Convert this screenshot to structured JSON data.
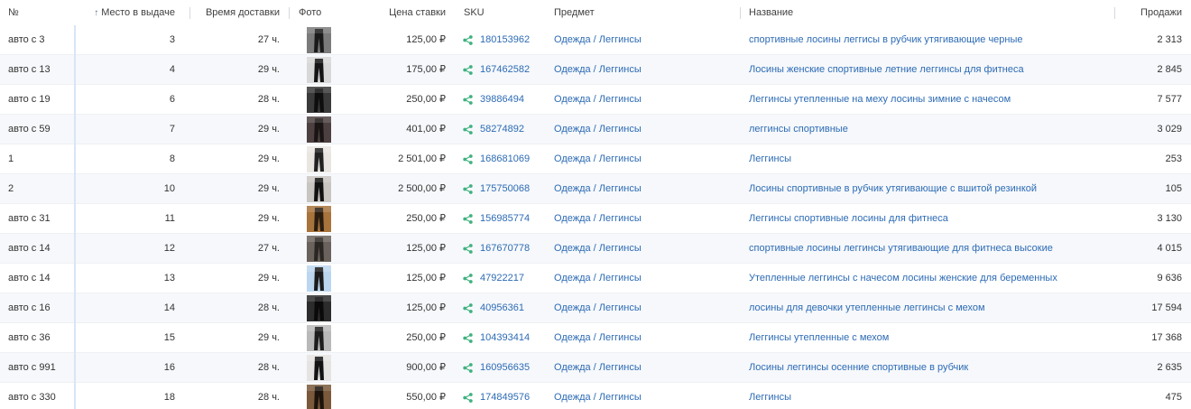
{
  "header": {
    "num": "№",
    "place": "Место в выдаче",
    "place_sort_icon": "sort-ascending-icon",
    "delivery": "Время доставки",
    "photo": "Фото",
    "price": "Цена ставки",
    "sku": "SKU",
    "subject": "Предмет",
    "name": "Название",
    "sales": "Продажи"
  },
  "colors": {
    "link": "#2d6bb5",
    "share_icon": "#3fb27f",
    "stripe": "#f6f8fb",
    "pinned_divider": "#d7e6f5"
  },
  "rows": [
    {
      "num": "авто с 3",
      "place": "3",
      "delivery": "27 ч.",
      "price": "125,00 ₽",
      "sku": "180153962",
      "subject": "Одежда / Леггинсы",
      "name": "спортивные лосины леггисы в рубчик утягивающие черные",
      "sales": "2 313"
    },
    {
      "num": "авто с 13",
      "place": "4",
      "delivery": "29 ч.",
      "price": "175,00 ₽",
      "sku": "167462582",
      "subject": "Одежда / Леггинсы",
      "name": "Лосины женские спортивные летние леггинсы для фитнеса",
      "sales": "2 845"
    },
    {
      "num": "авто с 19",
      "place": "6",
      "delivery": "28 ч.",
      "price": "250,00 ₽",
      "sku": "39886494",
      "subject": "Одежда / Леггинсы",
      "name": "Леггинсы утепленные на меху лосины зимние с начесом",
      "sales": "7 577"
    },
    {
      "num": "авто с 59",
      "place": "7",
      "delivery": "29 ч.",
      "price": "401,00 ₽",
      "sku": "58274892",
      "subject": "Одежда / Леггинсы",
      "name": "леггинсы спортивные",
      "sales": "3 029"
    },
    {
      "num": "1",
      "place": "8",
      "delivery": "29 ч.",
      "price": "2 501,00 ₽",
      "sku": "168681069",
      "subject": "Одежда / Леггинсы",
      "name": "Леггинсы",
      "sales": "253"
    },
    {
      "num": "2",
      "place": "10",
      "delivery": "29 ч.",
      "price": "2 500,00 ₽",
      "sku": "175750068",
      "subject": "Одежда / Леггинсы",
      "name": "Лосины спортивные в рубчик утягивающие с вшитой резинкой",
      "sales": "105"
    },
    {
      "num": "авто с 31",
      "place": "11",
      "delivery": "29 ч.",
      "price": "250,00 ₽",
      "sku": "156985774",
      "subject": "Одежда / Леггинсы",
      "name": "Леггинсы спортивные лосины для фитнеса",
      "sales": "3 130"
    },
    {
      "num": "авто с 14",
      "place": "12",
      "delivery": "27 ч.",
      "price": "125,00 ₽",
      "sku": "167670778",
      "subject": "Одежда / Леггинсы",
      "name": "спортивные лосины леггинсы утягивающие для фитнеса высокие",
      "sales": "4 015"
    },
    {
      "num": "авто с 14",
      "place": "13",
      "delivery": "29 ч.",
      "price": "125,00 ₽",
      "sku": "47922217",
      "subject": "Одежда / Леггинсы",
      "name": "Утепленные леггинсы с начесом лосины женские для беременных",
      "sales": "9 636"
    },
    {
      "num": "авто с 16",
      "place": "14",
      "delivery": "28 ч.",
      "price": "125,00 ₽",
      "sku": "40956361",
      "subject": "Одежда / Леггинсы",
      "name": "лосины для девочки утепленные леггинсы с мехом",
      "sales": "17 594"
    },
    {
      "num": "авто с 36",
      "place": "15",
      "delivery": "29 ч.",
      "price": "250,00 ₽",
      "sku": "104393414",
      "subject": "Одежда / Леггинсы",
      "name": "Леггинсы утепленные с мехом",
      "sales": "17 368"
    },
    {
      "num": "авто с 991",
      "place": "16",
      "delivery": "28 ч.",
      "price": "900,00 ₽",
      "sku": "160956635",
      "subject": "Одежда / Леггинсы",
      "name": "Лосины леггинсы осенние спортивные в рубчик",
      "sales": "2 635"
    },
    {
      "num": "авто с 330",
      "place": "18",
      "delivery": "28 ч.",
      "price": "550,00 ₽",
      "sku": "174849576",
      "subject": "Одежда / Леггинсы",
      "name": "Леггинсы",
      "sales": "475"
    }
  ]
}
